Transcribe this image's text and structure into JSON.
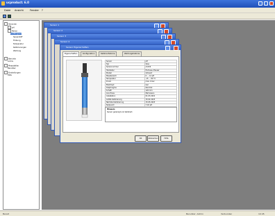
{
  "app": {
    "title": "ucproduct: 6.0"
  },
  "menu": [
    "Datei",
    "Ansicht",
    "Fenster",
    "?"
  ],
  "tree": {
    "items": [
      {
        "label": "Sensoren",
        "indent": 0
      },
      {
        "label": "pH",
        "indent": 1
      },
      {
        "label": "Redox",
        "indent": 1
      },
      {
        "label": "Leitfähigkeit",
        "indent": 1
      },
      {
        "label": "Sauerstoff",
        "indent": 1
      },
      {
        "label": "Trübung",
        "indent": 1
      },
      {
        "label": "Temperatur",
        "indent": 1
      },
      {
        "label": "Kalibrierungen",
        "indent": 0
      },
      {
        "label": "Wartung",
        "indent": 0
      },
      {
        "label": "Berichte",
        "indent": 0
      },
      {
        "label": "Archiv",
        "indent": 0
      },
      {
        "label": "Messstellen",
        "indent": 0
      },
      {
        "label": "Benutzer",
        "indent": 0
      },
      {
        "label": "Einstellungen",
        "indent": 0
      },
      {
        "label": "Hilfe",
        "indent": 0
      }
    ]
  },
  "windows": {
    "back": [
      "Sensor 1",
      "Sensor 2",
      "Sensor 3",
      "Sensor 4"
    ],
    "front": {
      "title": "Sensor Eigenschaften",
      "tabs": [
        "Eigenschaften",
        "Konfiguration",
        "Kalibrierhistorie",
        "Wartungshistorie"
      ],
      "table": [
        [
          "Sensor",
          "pH"
        ],
        [
          "Typ",
          "Glas"
        ],
        [
          "Seriennummer",
          "A1234"
        ],
        [
          "Hersteller",
          "Endress+Hauser"
        ],
        [
          "Modell",
          "Orbisint"
        ],
        [
          "Messbereich",
          "0 … 14 pH"
        ],
        [
          "Temperatur",
          "-15 … 80 °C"
        ],
        [
          "Druck",
          "max. 6 bar"
        ],
        [
          "Elektrolyt",
          "Gel"
        ],
        [
          "Diaphragma",
          "Keramik"
        ],
        [
          "Schaft",
          "120 mm"
        ],
        [
          "Anschluss",
          "Memosens"
        ],
        [
          "Installation",
          "01.03.2021"
        ],
        [
          "Letzte Kalibrierung",
          "15.02.2023"
        ],
        [
          "Nächste Kalibrierung",
          "15.05.2023"
        ],
        [
          "Nullpunkt",
          "7.02 pH"
        ],
        [
          "Steilheit",
          "98.5 %"
        ],
        [
          "Impedanz",
          "120 MΩ"
        ],
        [
          "Status",
          "OK"
        ],
        [
          "Betriebsstunden",
          "4200 h"
        ]
      ],
      "note_title": "Hinweis",
      "note_text": "Sensor gereinigt und kalibriert.",
      "buttons": [
        "OK",
        "Abbrechen",
        "Hilfe"
      ]
    }
  },
  "status": [
    "Bereit",
    "Benutzer: Admin",
    "Verbunden",
    "10:45"
  ]
}
